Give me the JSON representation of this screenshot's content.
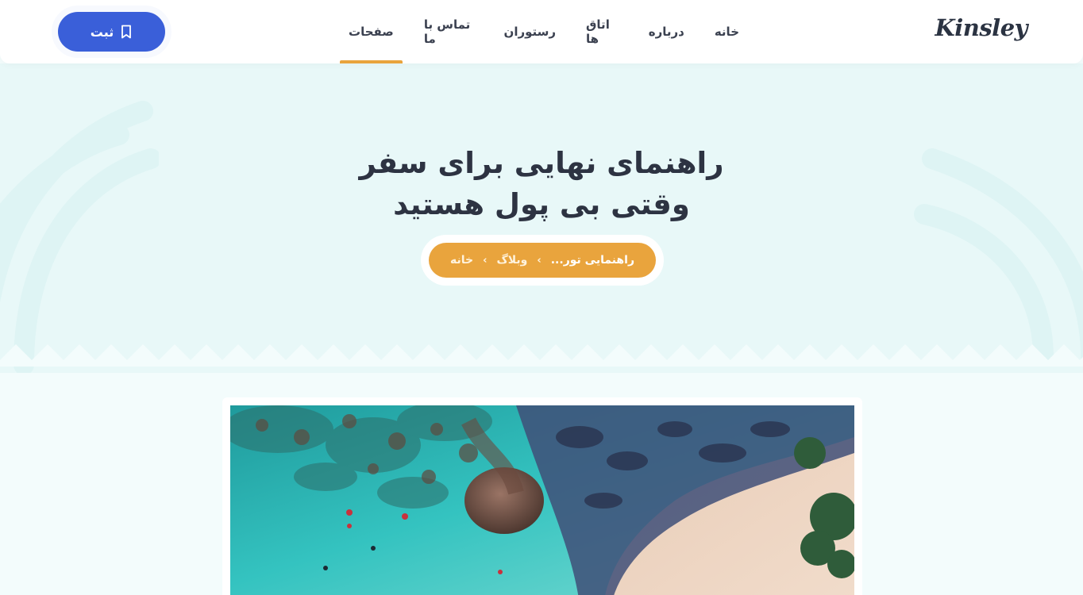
{
  "header": {
    "logo": "Kinsley",
    "nav": [
      {
        "label": "خانه",
        "active": false
      },
      {
        "label": "درباره",
        "active": false
      },
      {
        "label": "اتاق ها",
        "active": false
      },
      {
        "label": "رستوران",
        "active": false
      },
      {
        "label": "تماس با ما",
        "active": false
      },
      {
        "label": "صفحات",
        "active": true
      }
    ],
    "cta_label": "ثبت",
    "cta_icon": "bookmark-icon"
  },
  "hero": {
    "title_line1": "راهنمای نهایی برای سفر",
    "title_line2": "وقتی بی پول هستید",
    "breadcrumb": {
      "home": "خانه",
      "blog": "وبلاگ",
      "current": "راهنمایی تور...",
      "separator": "›"
    }
  },
  "colors": {
    "accent": "#e9a43d",
    "primary": "#3a5fd9",
    "hero_bg": "#e8f8f8",
    "text_dark": "#2d3342"
  },
  "photo": {
    "subject": "aerial-beach-photo"
  }
}
